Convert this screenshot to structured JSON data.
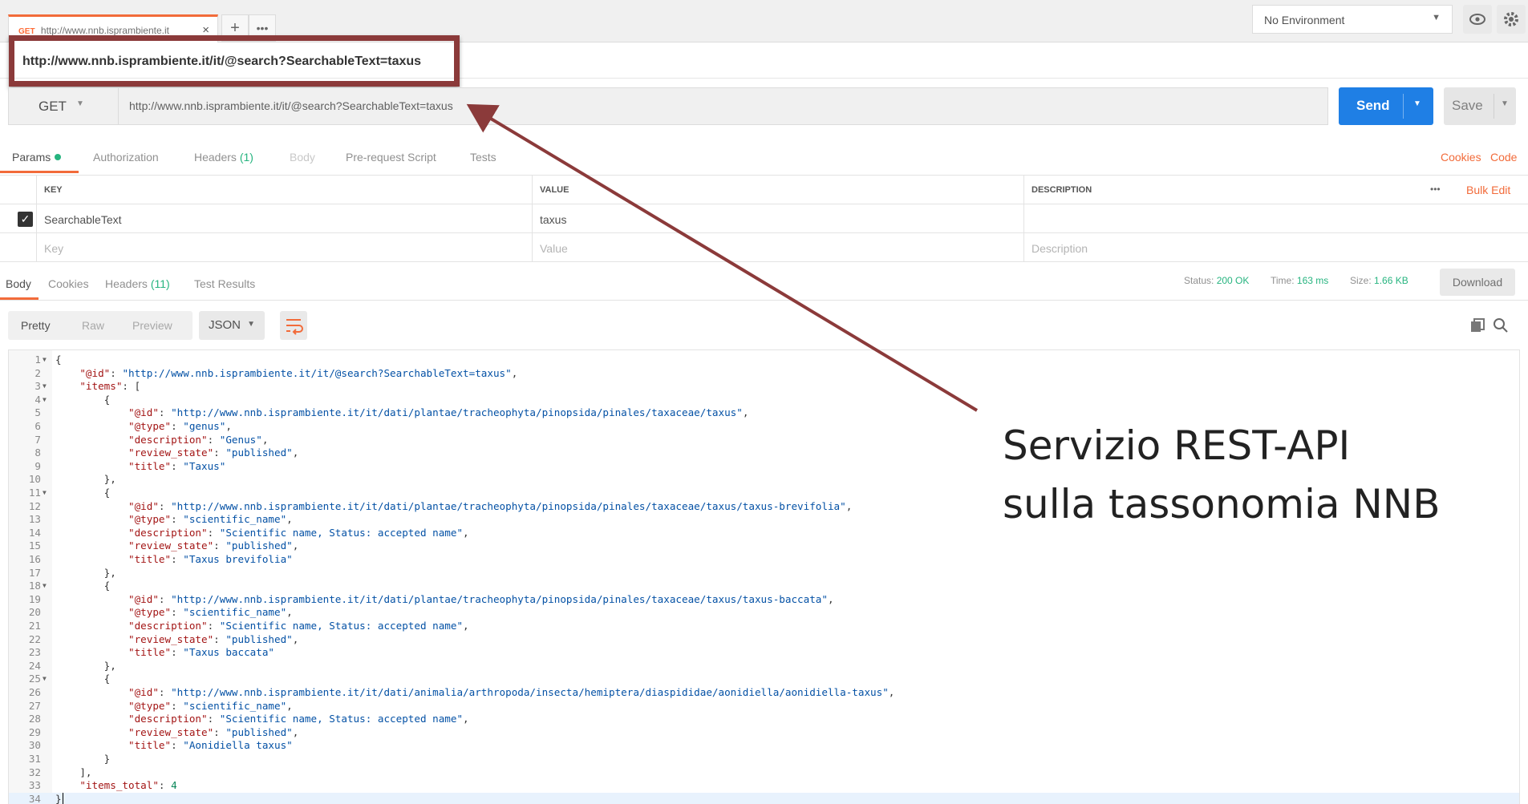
{
  "tab": {
    "method": "GET",
    "url": "http://www.nnb.isprambiente.it"
  },
  "environment": {
    "selected": "No Environment"
  },
  "request": {
    "title": "http://www.nnb.isprambiente.it/it/@search?SearchableText=taxus",
    "method": "GET",
    "url": "http://www.nnb.isprambiente.it/it/@search?SearchableText=taxus",
    "send_label": "Send",
    "save_label": "Save"
  },
  "request_tabs": [
    {
      "label": "Params"
    },
    {
      "label": "Authorization"
    },
    {
      "label": "Headers",
      "count": "(1)"
    },
    {
      "label": "Body"
    },
    {
      "label": "Pre-request Script"
    },
    {
      "label": "Tests"
    }
  ],
  "links": {
    "cookies": "Cookies",
    "code": "Code",
    "bulk_edit": "Bulk Edit",
    "more": "•••"
  },
  "params": {
    "headers": {
      "key": "KEY",
      "value": "VALUE",
      "description": "DESCRIPTION"
    },
    "rows": [
      {
        "checked": true,
        "key": "SearchableText",
        "value": "taxus",
        "description": ""
      }
    ],
    "placeholders": {
      "key": "Key",
      "value": "Value",
      "description": "Description"
    }
  },
  "response_tabs": [
    {
      "label": "Body"
    },
    {
      "label": "Cookies"
    },
    {
      "label": "Headers",
      "count": "(11)"
    },
    {
      "label": "Test Results"
    }
  ],
  "status": {
    "status_label": "Status:",
    "status_value": "200 OK",
    "time_label": "Time:",
    "time_value": "163 ms",
    "size_label": "Size:",
    "size_value": "1.66 KB",
    "download_label": "Download"
  },
  "view_modes": [
    "Pretty",
    "Raw",
    "Preview"
  ],
  "format": "JSON",
  "code_lines": [
    "{",
    "    \"@id\": \"http://www.nnb.isprambiente.it/it/@search?SearchableText=taxus\",",
    "    \"items\": [",
    "        {",
    "            \"@id\": \"http://www.nnb.isprambiente.it/it/dati/plantae/tracheophyta/pinopsida/pinales/taxaceae/taxus\",",
    "            \"@type\": \"genus\",",
    "            \"description\": \"Genus\",",
    "            \"review_state\": \"published\",",
    "            \"title\": \"Taxus\"",
    "        },",
    "        {",
    "            \"@id\": \"http://www.nnb.isprambiente.it/it/dati/plantae/tracheophyta/pinopsida/pinales/taxaceae/taxus/taxus-brevifolia\",",
    "            \"@type\": \"scientific_name\",",
    "            \"description\": \"Scientific name, Status: accepted name\",",
    "            \"review_state\": \"published\",",
    "            \"title\": \"Taxus brevifolia\"",
    "        },",
    "        {",
    "            \"@id\": \"http://www.nnb.isprambiente.it/it/dati/plantae/tracheophyta/pinopsida/pinales/taxaceae/taxus/taxus-baccata\",",
    "            \"@type\": \"scientific_name\",",
    "            \"description\": \"Scientific name, Status: accepted name\",",
    "            \"review_state\": \"published\",",
    "            \"title\": \"Taxus baccata\"",
    "        },",
    "        {",
    "            \"@id\": \"http://www.nnb.isprambiente.it/it/dati/animalia/arthropoda/insecta/hemiptera/diaspididae/aonidiella/aonidiella-taxus\",",
    "            \"@type\": \"scientific_name\",",
    "            \"description\": \"Scientific name, Status: accepted name\",",
    "            \"review_state\": \"published\",",
    "            \"title\": \"Aonidiella taxus\"",
    "        }",
    "    ],",
    "    \"items_total\": 4",
    "}"
  ],
  "fold_lines": [
    1,
    3,
    4,
    11,
    18,
    25
  ],
  "annotation": {
    "line1": "Servizio REST-API",
    "line2": "sulla tassonomia NNB"
  },
  "colors": {
    "accent": "#f26b3a",
    "send": "#1f7fe5",
    "success": "#26b47f",
    "annotation": "#8b3a3a"
  }
}
